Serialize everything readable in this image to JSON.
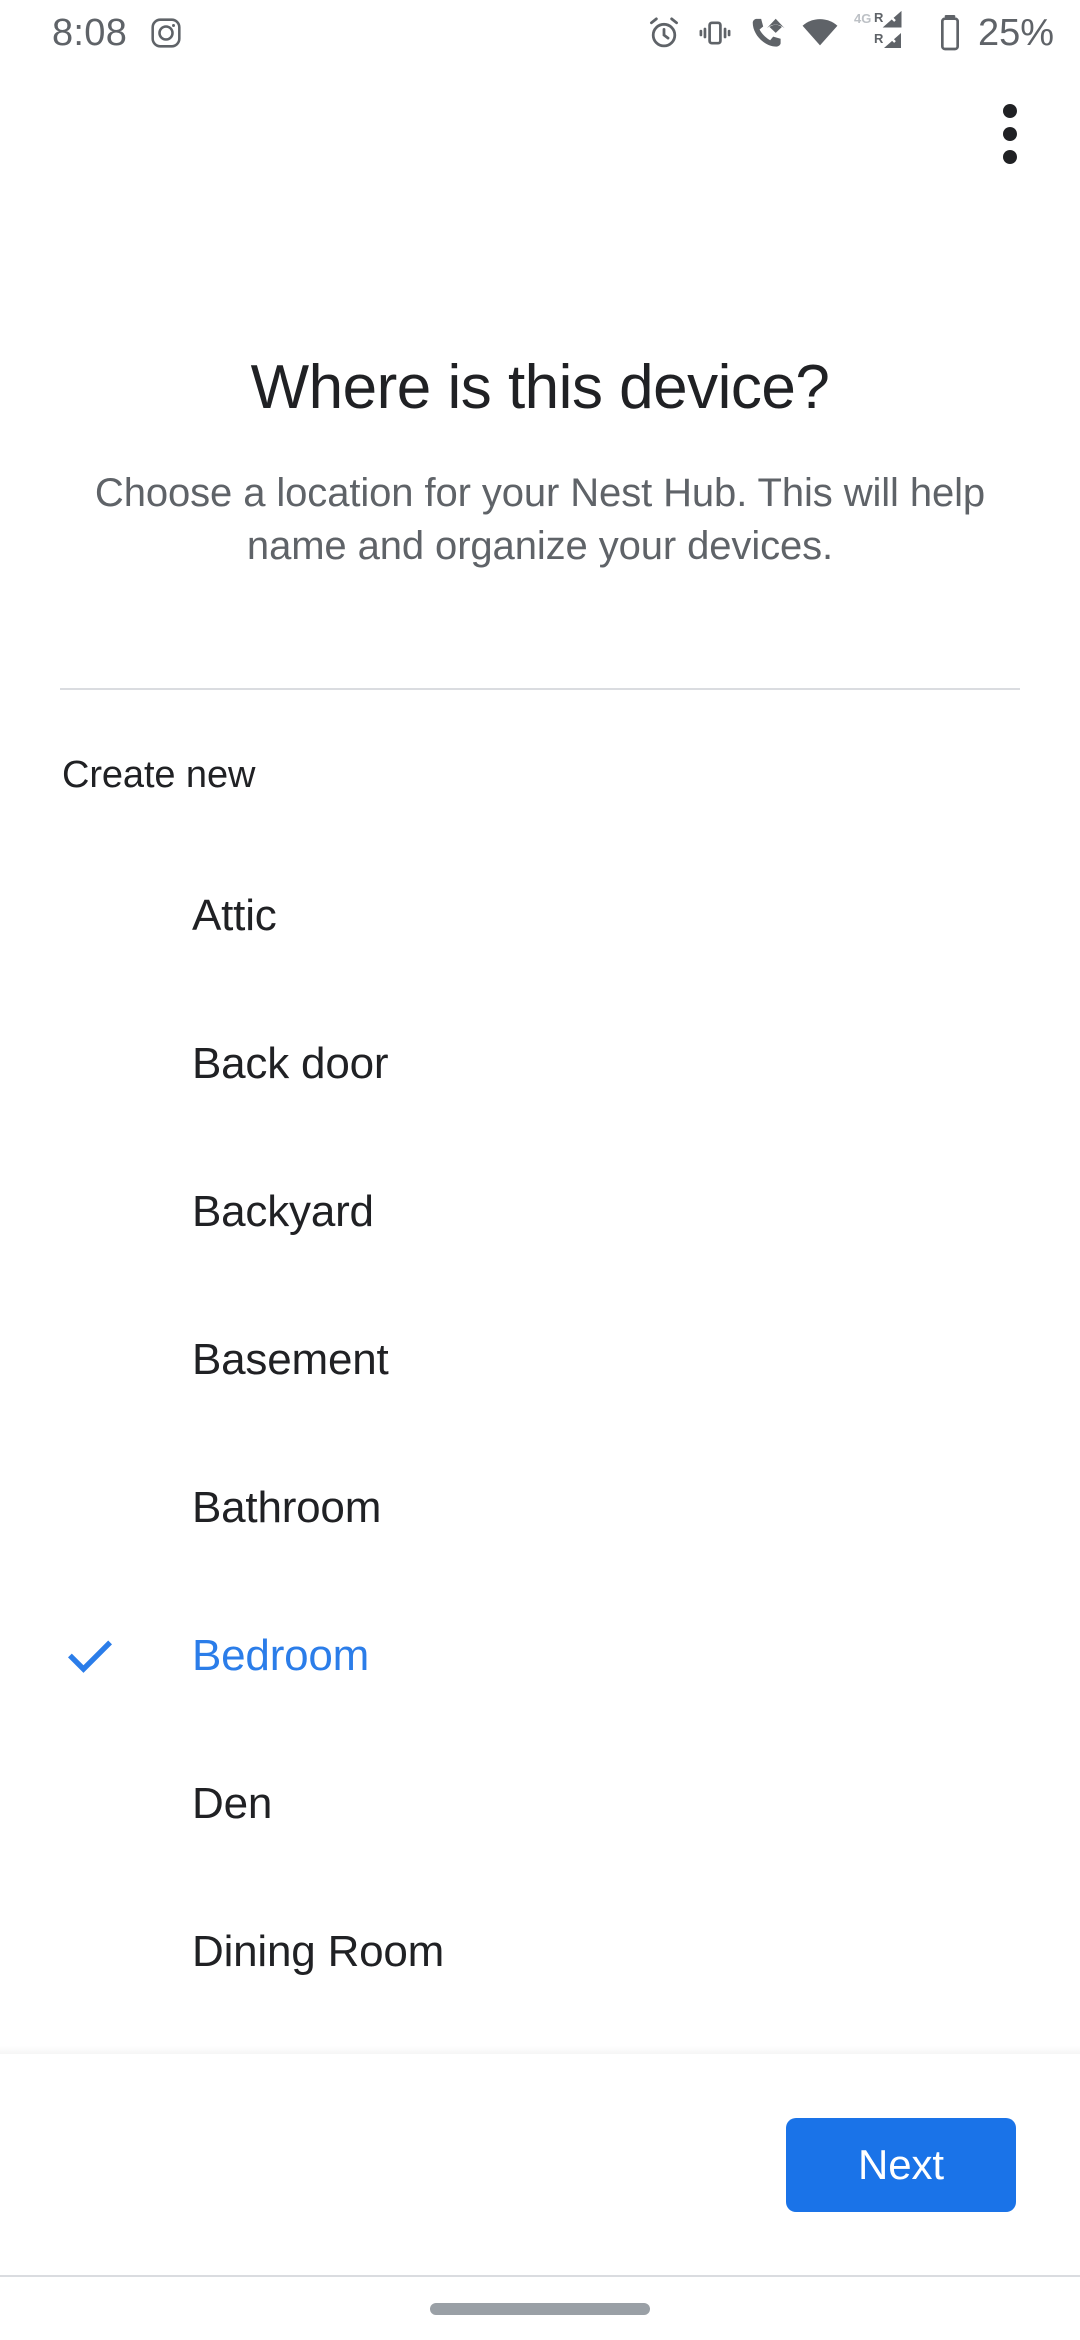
{
  "status_bar": {
    "time": "8:08",
    "battery_percent": "25%",
    "icons": [
      "instagram-notification-icon",
      "alarm-clock-icon",
      "vibrate-icon",
      "wifi-calling-icon",
      "wifi-icon",
      "4g-roaming-signal-icon",
      "battery-icon"
    ],
    "network_label": "4G",
    "roaming_label_1": "R",
    "roaming_label_2": "R"
  },
  "app_bar": {
    "overflow_menu_label": "More options"
  },
  "header": {
    "title": "Where is this device?",
    "subtitle": "Choose a location for your Nest Hub. This will help name and organize your devices."
  },
  "list": {
    "create_new_label": "Create new",
    "selected_room": "Bedroom",
    "items": [
      {
        "label": "Attic",
        "selected": false
      },
      {
        "label": "Back door",
        "selected": false
      },
      {
        "label": "Backyard",
        "selected": false
      },
      {
        "label": "Basement",
        "selected": false
      },
      {
        "label": "Bathroom",
        "selected": false
      },
      {
        "label": "Bedroom",
        "selected": true
      },
      {
        "label": "Den",
        "selected": false
      },
      {
        "label": "Dining Room",
        "selected": false
      }
    ]
  },
  "footer": {
    "next_label": "Next"
  },
  "nav_bar": {
    "home_pill_label": "Home"
  },
  "colors": {
    "accent_blue": "#1a73e8",
    "selected_text_blue": "#2b7de9",
    "primary_text": "#202124",
    "secondary_text": "#5f6368",
    "divider": "#dadce0",
    "nav_pill": "#9aa0a6",
    "background": "#ffffff"
  }
}
